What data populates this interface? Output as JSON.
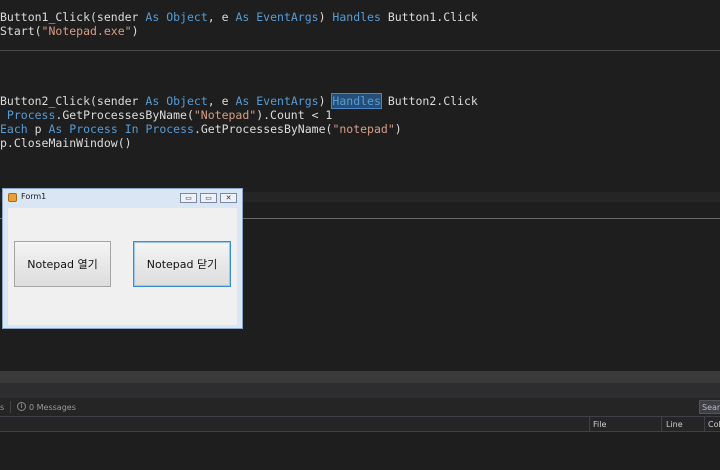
{
  "code": {
    "line1": {
      "a": "Button1_Click(sender ",
      "kw1": "As",
      "b": " ",
      "kw2": "Object",
      "c": ", e ",
      "kw3": "As",
      "d": " ",
      "kw4": "EventArgs",
      "e": ") ",
      "kw5": "Handles",
      "f": " Button1.Click"
    },
    "line2": {
      "a": "Start(",
      "str": "\"Notepad.exe\"",
      "b": ")"
    },
    "line3": {
      "a": "Button2_Click(sender ",
      "kw1": "As",
      "b": " ",
      "kw2": "Object",
      "c": ", e ",
      "kw3": "As",
      "d": " ",
      "kw4": "EventArgs",
      "e": ") ",
      "hl": "Handles",
      "f": " Button2.Click"
    },
    "line4": {
      "kw1": " Process",
      "a": ".GetProcessesByName(",
      "str": "\"Notepad\"",
      "b": ").Count < 1"
    },
    "line5": {
      "kw1": "Each",
      "a": " p ",
      "kw2": "As",
      "b": " ",
      "kw3": "Process",
      "c": " ",
      "kw4": "In",
      "d": " ",
      "kw5": "Process",
      "e": ".GetProcessesByName(",
      "str": "\"notepad\"",
      "f": ")"
    },
    "line6": {
      "a": "p.CloseMainWindow()"
    }
  },
  "form": {
    "title": "Form1",
    "min_glyph": "▭",
    "max_glyph": "▭",
    "close_glyph": "✕",
    "open_button": "Notepad 열기",
    "close_button": "Notepad 닫기"
  },
  "error_list": {
    "warnings_tab": "s",
    "messages_tab": "0 Messages",
    "search_label": "Searc",
    "columns": [
      "File",
      "Line",
      "Col"
    ]
  },
  "colors": {
    "keyword": "#569cd6",
    "string": "#d69d85",
    "editor_bg": "#1e1e1e"
  },
  "icons": {
    "form_icon": "app-icon",
    "messages_icon": "info-icon"
  }
}
